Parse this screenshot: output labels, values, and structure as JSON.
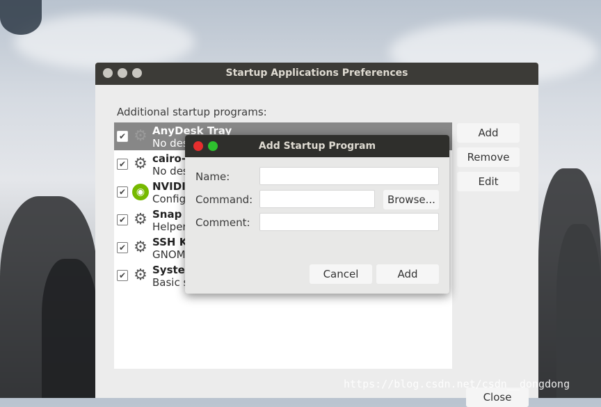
{
  "main_window": {
    "title": "Startup Applications Preferences",
    "section_label": "Additional startup programs:",
    "programs": [
      {
        "name": "AnyDesk Tray",
        "description": "No des",
        "checked": true,
        "selected": true,
        "icon": "gear-icon"
      },
      {
        "name": "cairo-c",
        "description": "No des",
        "checked": true,
        "selected": false,
        "icon": "gear-icon"
      },
      {
        "name": "NVIDIA",
        "description": "Config",
        "checked": true,
        "selected": false,
        "icon": "nvidia-icon"
      },
      {
        "name": "Snap u",
        "description": "Helper",
        "checked": true,
        "selected": false,
        "icon": "gear-icon"
      },
      {
        "name": "SSH Ke",
        "description": "GNOM",
        "checked": true,
        "selected": false,
        "icon": "gear-icon"
      },
      {
        "name": "Syster",
        "description": "Basic s",
        "checked": true,
        "selected": false,
        "icon": "gear-icon"
      }
    ],
    "buttons": {
      "add": "Add",
      "remove": "Remove",
      "edit": "Edit",
      "close": "Close"
    }
  },
  "dialog": {
    "title": "Add Startup Program",
    "labels": {
      "name": "Name:",
      "command": "Command:",
      "comment": "Comment:"
    },
    "values": {
      "name": "",
      "command": "",
      "comment": ""
    },
    "browse_label": "Browse...",
    "cancel_label": "Cancel",
    "add_label": "Add",
    "close_color": "#e62e2e",
    "maximize_color": "#2ec12e"
  },
  "watermark": "https://blog.csdn.net/csdn__dongdong",
  "colors": {
    "titlebar": "#3c3b37",
    "selection": "#878787"
  }
}
